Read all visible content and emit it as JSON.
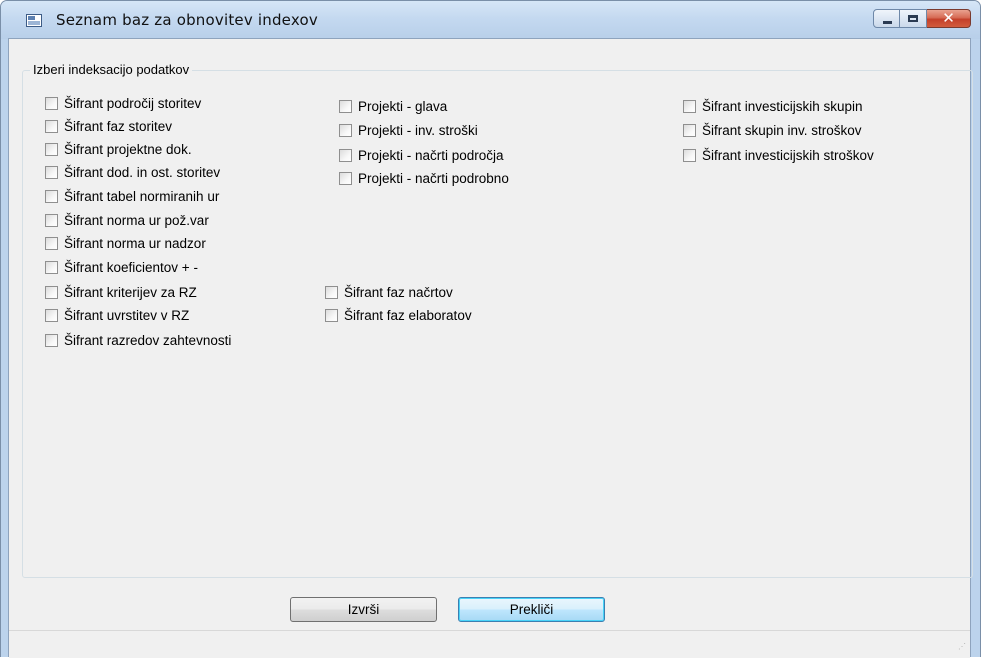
{
  "window": {
    "title": "Seznam baz za obnovitev indexov",
    "close_glyph": "✕"
  },
  "group": {
    "label": "Izberi indeksacijo podatkov"
  },
  "column1": [
    {
      "label": "Šifrant področij storitev",
      "checked": false
    },
    {
      "label": "Šifrant faz storitev",
      "checked": false
    },
    {
      "label": "Šifrant projektne dok.",
      "checked": false
    },
    {
      "label": "Šifrant dod. in ost. storitev",
      "checked": false
    },
    {
      "label": "Šifrant tabel normiranih ur",
      "checked": false
    },
    {
      "label": "Šifrant norma ur pož.var",
      "checked": false
    },
    {
      "label": "Šifrant norma ur nadzor",
      "checked": false
    },
    {
      "label": "Šifrant koeficientov + -",
      "checked": false
    },
    {
      "label": "Šifrant kriterijev za RZ",
      "checked": false
    },
    {
      "label": "Šifrant uvrstitev v RZ",
      "checked": false
    },
    {
      "label": "Šifrant razredov zahtevnosti",
      "checked": false
    }
  ],
  "column2": [
    {
      "label": "Projekti - glava",
      "checked": false
    },
    {
      "label": "Projekti - inv. stroški",
      "checked": false
    },
    {
      "label": "Projekti - načrti področja",
      "checked": false
    },
    {
      "label": "Projekti - načrti podrobno",
      "checked": false
    }
  ],
  "column2b": [
    {
      "label": "Šifrant faz načrtov",
      "checked": false
    },
    {
      "label": "Šifrant faz elaboratov",
      "checked": false
    }
  ],
  "column3": [
    {
      "label": "Šifrant investicijskih skupin",
      "checked": false
    },
    {
      "label": "Šifrant skupin inv. stroškov",
      "checked": false
    },
    {
      "label": "Šifrant investicijskih stroškov",
      "checked": false
    }
  ],
  "buttons": {
    "execute": "Izvrši",
    "cancel": "Prekliči"
  }
}
